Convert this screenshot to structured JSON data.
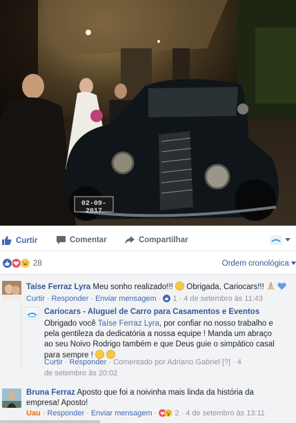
{
  "photo": {
    "plate": "02-09-2017",
    "alt": "wedding-classic-car-photo"
  },
  "actions": {
    "like": "Curtir",
    "comment": "Comentar",
    "share": "Compartilhar"
  },
  "reactions": {
    "count": "28",
    "sort_label": "Ordem cronológica"
  },
  "comments": [
    {
      "author": "Taíse Ferraz Lyra",
      "text_before": "Meu sonho realizado!!!",
      "text_after": "Obrigada, Cariocars!!!",
      "like": "Curtir",
      "reply": "Responder",
      "message": "Enviar mensagem",
      "likes": "1",
      "date": "4 de setembro às 11:43"
    },
    {
      "author": "Cariocars - Aluguel de Carro para Casamentos e Eventos",
      "text_1": "Obrigado você ",
      "mention": "Taíse Ferraz Lyra",
      "text_2": ", por confiar no nosso trabalho e pela gentileza da dedicatória a nossa equipe ! Manda um abraço ao seu Noivo Rodrigo também e que Deus guie o simpático casal para sempre !",
      "like": "Curtir",
      "reply": "Responder",
      "by": "Comentado por Adriano Gabriel",
      "help": "[?]",
      "date": "4 de setembro às 20:02"
    },
    {
      "author": "Bruna Ferraz",
      "text": "Aposto que foi a noivinha mais linda da história da empresa! Aposto!",
      "like": "Uau",
      "reply": "Responder",
      "message": "Enviar mensagem",
      "likes": "2",
      "date": "4 de setembro às 13:11"
    }
  ],
  "colors": {
    "link": "#4267b2",
    "like_blue": "#4267b2",
    "love_red": "#f25268",
    "haha_yellow": "#f7c844",
    "wow_orange": "#e9710f"
  }
}
